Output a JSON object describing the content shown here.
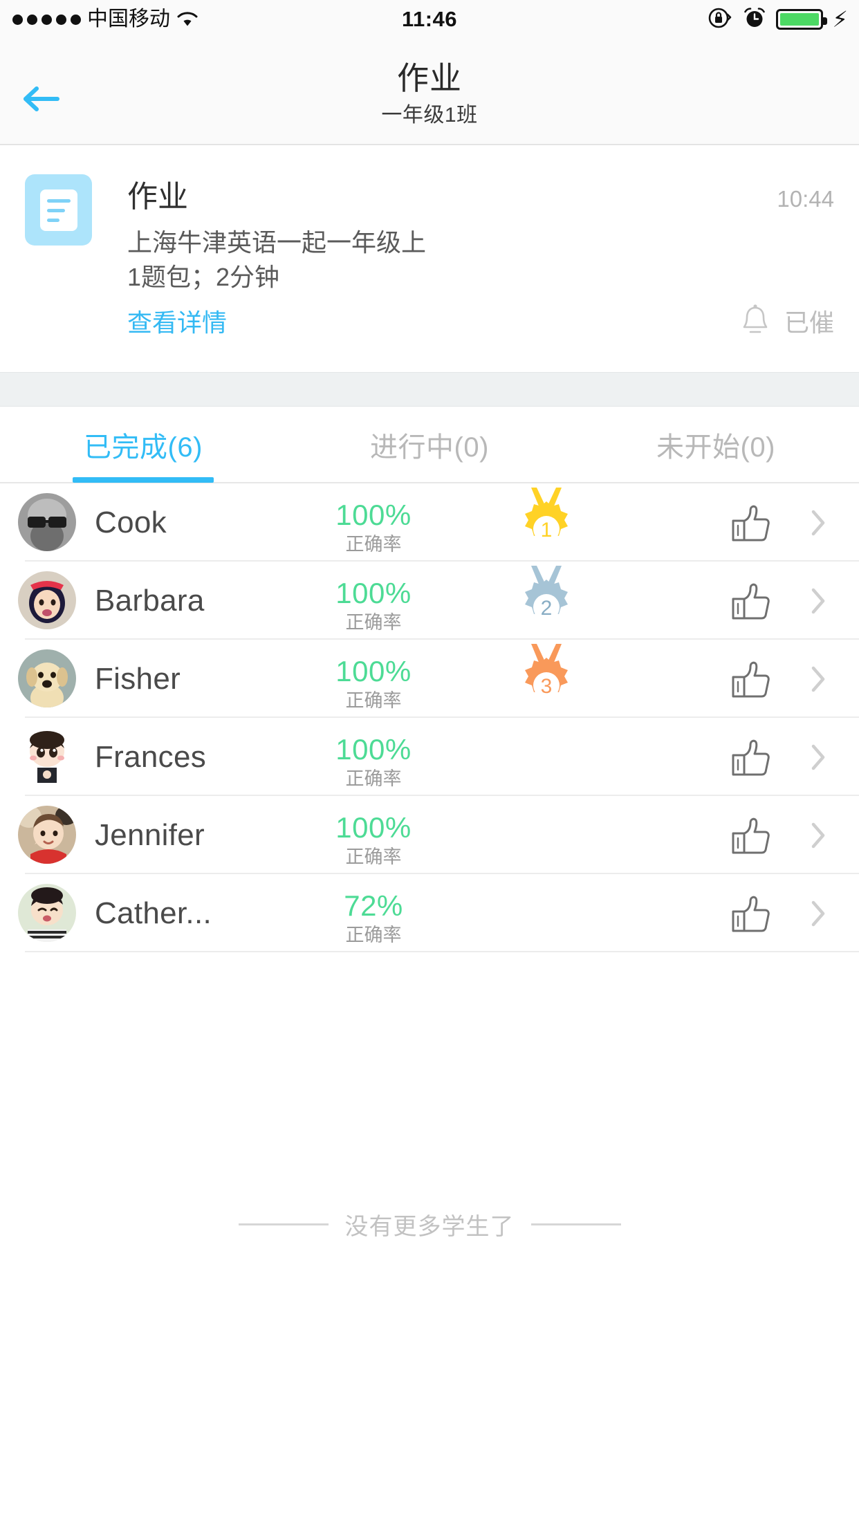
{
  "status_bar": {
    "signal_dots": 5,
    "carrier": "中国移动",
    "wifi_icon": "wifi-icon",
    "time": "11:46",
    "rotation_lock_icon": "rotation-lock-icon",
    "alarm_icon": "alarm-clock-icon",
    "battery_icon": "battery-icon",
    "battery_color": "#4cd964",
    "charging_icon": "lightning-bolt-icon"
  },
  "nav": {
    "back_icon": "back-arrow-icon",
    "title": "作业",
    "subtitle": "一年级1班",
    "accent_color": "#32bcf6"
  },
  "card": {
    "icon_name": "homework-document-icon",
    "icon_bg": "#ade4fb",
    "title": "作业",
    "time": "10:44",
    "desc_line1": "上海牛津英语一起一年级上",
    "desc_line2": "1题包；2分钟",
    "detail_link": "查看详情",
    "link_color": "#34b9f3",
    "bell_icon": "bell-icon",
    "remind_label": "已催"
  },
  "tabs": {
    "active_index": 0,
    "items": [
      {
        "label": "已完成(6)"
      },
      {
        "label": "进行中(0)"
      },
      {
        "label": "未开始(0)"
      }
    ]
  },
  "list": {
    "accuracy_label": "正确率",
    "score_color": "#4ddb95",
    "thumb_icon": "thumbs-up-icon",
    "chevron_icon": "chevron-right-icon",
    "rows": [
      {
        "name": "Cook",
        "score": "100%",
        "label": "正确率",
        "rank": "1",
        "medal_color": "#ffd226",
        "avatar": "avatar-cook"
      },
      {
        "name": "Barbara",
        "score": "100%",
        "label": "正确率",
        "rank": "2",
        "medal_color": "#a6c4d6",
        "avatar": "avatar-barbara"
      },
      {
        "name": "Fisher",
        "score": "100%",
        "label": "正确率",
        "rank": "3",
        "medal_color": "#f9995a",
        "avatar": "avatar-fisher"
      },
      {
        "name": "Frances",
        "score": "100%",
        "label": "正确率",
        "rank": "",
        "medal_color": "",
        "avatar": "avatar-frances"
      },
      {
        "name": "Jennifer",
        "score": "100%",
        "label": "正确率",
        "rank": "",
        "medal_color": "",
        "avatar": "avatar-jennifer"
      },
      {
        "name": "Cather...",
        "score": "72%",
        "label": "正确率",
        "rank": "",
        "medal_color": "",
        "avatar": "avatar-catherine"
      }
    ]
  },
  "footer": {
    "text": "没有更多学生了"
  }
}
